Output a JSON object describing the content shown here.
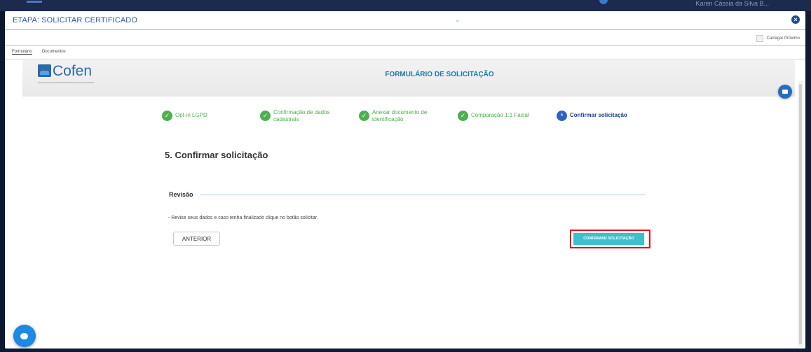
{
  "background": {
    "user_name": "Karen Cássia da Silva B..."
  },
  "dialog": {
    "title": "ETAPA: SOLICITAR CERTIFICADO",
    "load_next_label": "Carregar Próximo",
    "tabs": [
      {
        "label": "Formulário",
        "active": true
      },
      {
        "label": "Documentos",
        "active": false
      }
    ]
  },
  "form": {
    "logo_text": "Cofen",
    "title": "FORMULÁRIO DE SOLICITAÇÃO",
    "steps": [
      {
        "label": "Opt-in LGPD",
        "status": "done"
      },
      {
        "label_line1": "Confirmação de dados",
        "label_line2": "cadastrais",
        "status": "done"
      },
      {
        "label_line1": "Anexar documento de",
        "label_line2": "identificação",
        "status": "done"
      },
      {
        "label": "Comparação 1:1 Facial",
        "status": "done"
      },
      {
        "number": "5",
        "label": "Confirmar solicitação",
        "status": "current"
      }
    ],
    "section_title": "5. Confirmar solicitação",
    "review_label": "Revisão",
    "review_text": "- Revise seus dados e caso tenha finalizado clique no botão solicitar.",
    "prev_button": "ANTERIOR",
    "confirm_button": "CONFIRMAR SOLICITAÇÃO"
  },
  "colors": {
    "accent": "#1e7ba8",
    "done": "#4caf50",
    "current": "#2e62c2",
    "confirm": "#3cc0cc",
    "highlight": "#e0141e"
  }
}
